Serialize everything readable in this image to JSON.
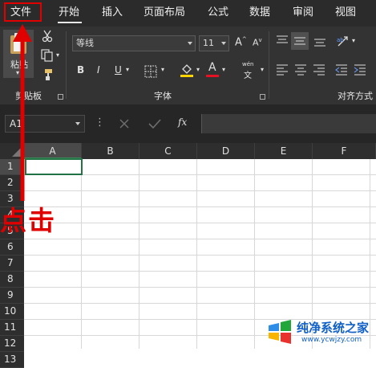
{
  "tabs": [
    "文件",
    "开始",
    "插入",
    "页面布局",
    "公式",
    "数据",
    "审阅",
    "视图"
  ],
  "ribbon": {
    "clipboard": {
      "paste": "粘贴",
      "group_label": "剪贴板"
    },
    "font": {
      "name": "等线",
      "size": "11",
      "grow": "A",
      "shrink": "A",
      "bold": "B",
      "italic": "I",
      "underline": "U",
      "font_color": "A",
      "phonetic_top": "wén",
      "phonetic_bottom": "文",
      "group_label": "字体"
    },
    "alignment": {
      "group_label": "对齐方式"
    }
  },
  "formula_bar": {
    "name_box": "A1",
    "fx": "fx",
    "dots": "⋮"
  },
  "columns": [
    "A",
    "B",
    "C",
    "D",
    "E",
    "F"
  ],
  "rows": [
    "1",
    "2",
    "3",
    "4",
    "5",
    "6",
    "7",
    "8",
    "9",
    "10",
    "11",
    "12",
    "13"
  ],
  "annotation": "点击",
  "watermark": {
    "line1": "纯净系统之家",
    "line2": "www.ycwjzy.com"
  },
  "colors": {
    "highlight_red": "#e00000",
    "selection_green": "#217346",
    "ribbon_bg": "#333333"
  }
}
